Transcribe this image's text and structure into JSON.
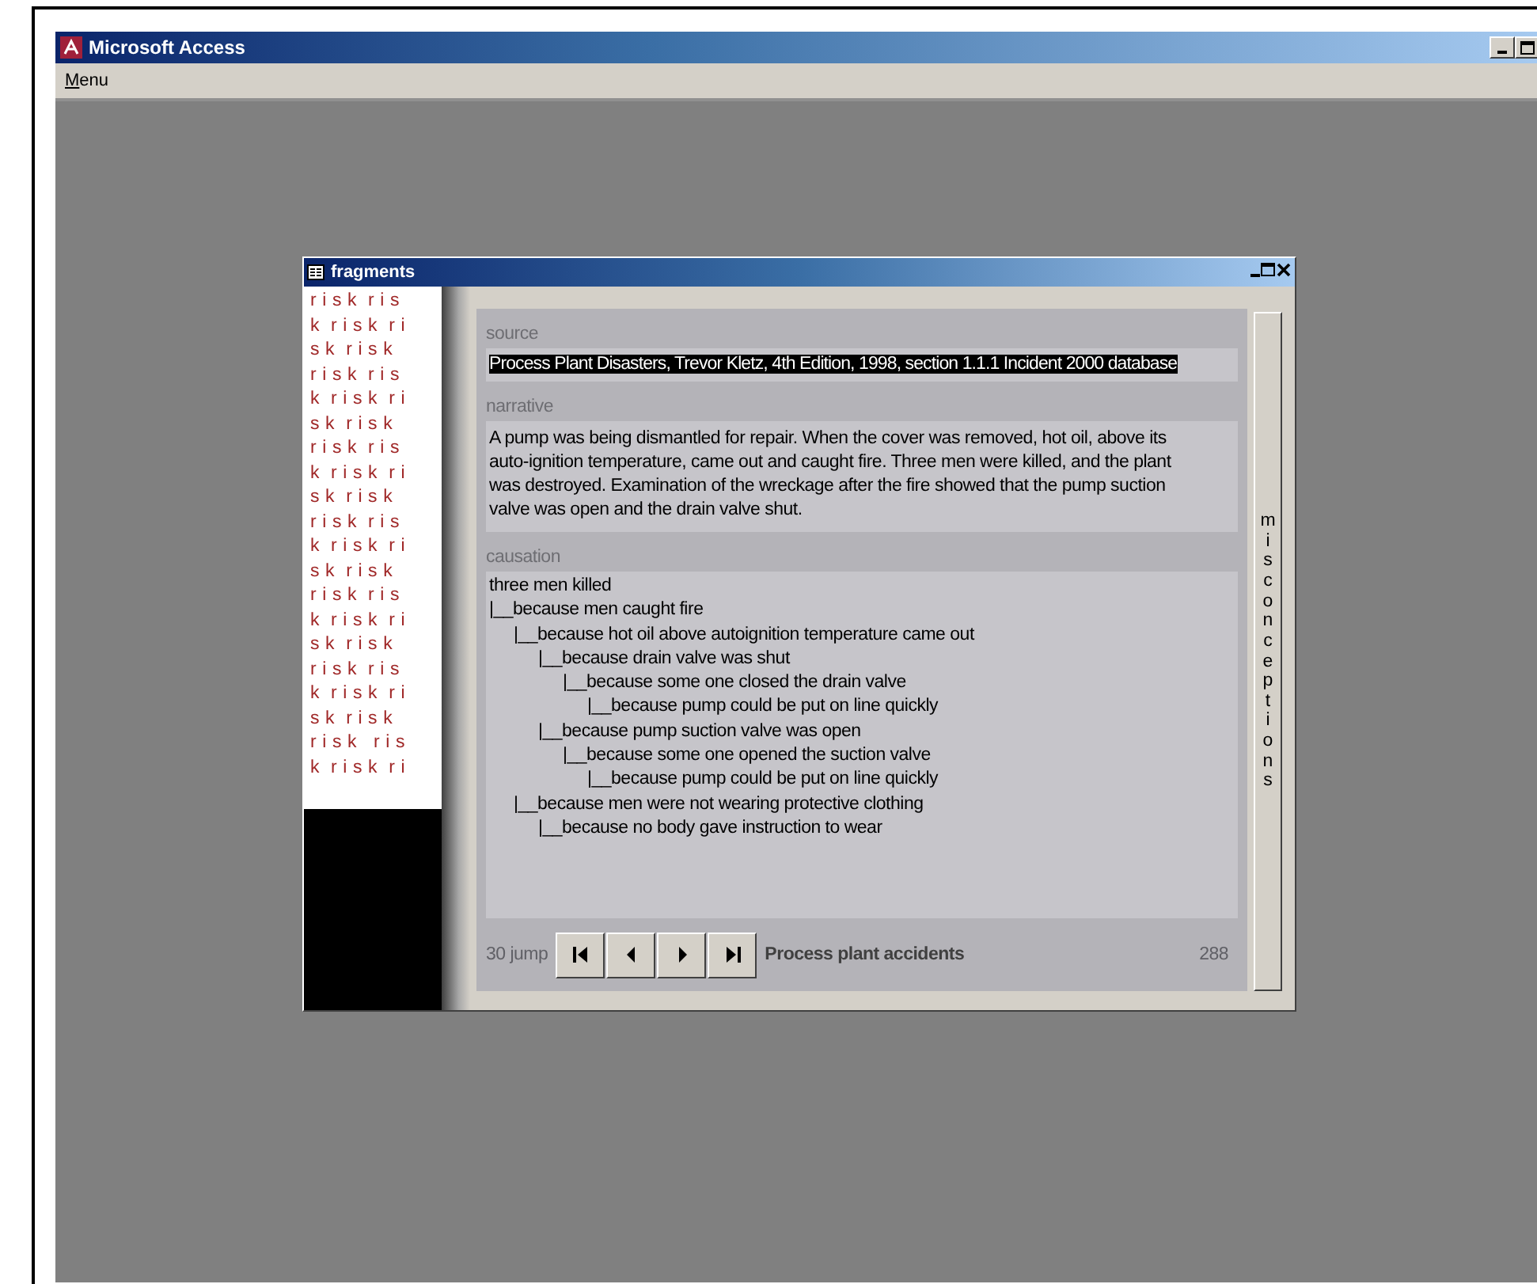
{
  "window": {
    "title": "Microsoft Access"
  },
  "menu": [
    {
      "label": "Menu"
    }
  ],
  "form": {
    "title": "fragments",
    "pattern_lines": [
      "r i s k  r i s",
      "k  r i s k  r i",
      "s k  r i s k",
      "r i s k  r i s",
      "k  r i s k  r i",
      "s k  r i s k",
      "r i s k  r i s",
      "k  r i s k  r i",
      "s k  r i s k",
      "r i s k  r i s",
      "k  r i s k  r i",
      "s k  r i s k",
      "r i s k  r i s",
      "k  r i s k  r i",
      "s k  r i s k",
      "r i s k  r i s",
      "k  r i s k  r i",
      "s k  r i s k",
      "r i s k   r i s",
      "k  r i s k  r i"
    ],
    "source": {
      "label": "source",
      "value": "Process Plant Disasters, Trevor Kletz, 4th Edition, 1998, section 1.1.1 Incident 2000 database",
      "selected": true
    },
    "narrative": {
      "label": "narrative",
      "value": "A pump was being dismantled for repair. When the cover was removed, hot oil, above its auto-ignition temperature, came out and caught fire. Three men were killed, and the plant was destroyed. Examination of the wreckage after the fire showed that the pump suction valve was open and the drain valve shut."
    },
    "causation": {
      "label": "causation",
      "tree": {
        "text": "three men killed",
        "children": [
          {
            "text": "|__because men caught fire",
            "children": [
              {
                "text": "|__because hot oil above autoignition temperature came out",
                "children": [
                  {
                    "text": "|__because drain valve was shut",
                    "children": [
                      {
                        "text": "|__because some one closed the drain valve",
                        "children": [
                          {
                            "text": "|__because pump could be put on line quickly"
                          }
                        ]
                      }
                    ]
                  },
                  {
                    "text": "|__because pump suction valve was open",
                    "children": [
                      {
                        "text": "|__because some one opened the suction valve",
                        "children": [
                          {
                            "text": "|__because pump could be put on line quickly"
                          }
                        ]
                      }
                    ]
                  }
                ]
              },
              {
                "text": "|__because men were not wearing protective clothing",
                "children": [
                  {
                    "text": "|__because no body gave instruction to wear"
                  }
                ]
              }
            ]
          }
        ]
      }
    },
    "nav": {
      "jump": "30 jump",
      "caption": "Process plant accidents",
      "count": "288"
    },
    "side_button": "misconceptions"
  }
}
